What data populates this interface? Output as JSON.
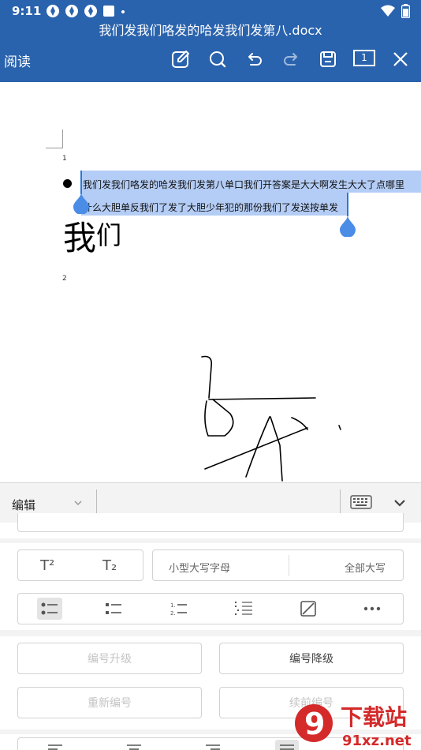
{
  "status_bar": {
    "time": "9:11"
  },
  "toolbar": {
    "mode_label": "阅读",
    "document_title": "我们发我们咯发的哈发我们发第八.docx",
    "page_count": "1",
    "icons": [
      "edit-icon",
      "search-icon",
      "undo-icon",
      "redo-icon",
      "save-icon",
      "page-count-icon",
      "close-icon"
    ]
  },
  "document": {
    "page_marker_1": "1",
    "page_marker_2": "2",
    "line1": "我们发我们咯发的哈发我们发第八单口我们开答案是大大啊发生大大了点哪里",
    "line2": "什么大胆单反我们了发了大胆少年犯的那份我们了发送按单发",
    "big_text_main": "我",
    "big_text_small": "们",
    "selection_color": "#b4cdf6"
  },
  "edit_panel": {
    "mode_select": "编辑",
    "superscript_label": "T²",
    "subscript_label": "T₂",
    "small_caps_label": "小型大写字母",
    "all_caps_label": "全部大写",
    "list_styles": [
      "bullet-list-circle",
      "bullet-list-square",
      "numbered-list",
      "multilevel-list",
      "no-list",
      "more"
    ],
    "promote_label": "编号升级",
    "demote_label": "编号降级",
    "restart_label": "重新编号",
    "continue_label": "续前编号"
  },
  "watermark": {
    "brand": "下载站",
    "domain": "91xz.net",
    "logo": "9"
  },
  "colors": {
    "toolbar": "#2a63ad",
    "accent": "#2a78d6",
    "watermark": "#d42a2a"
  }
}
